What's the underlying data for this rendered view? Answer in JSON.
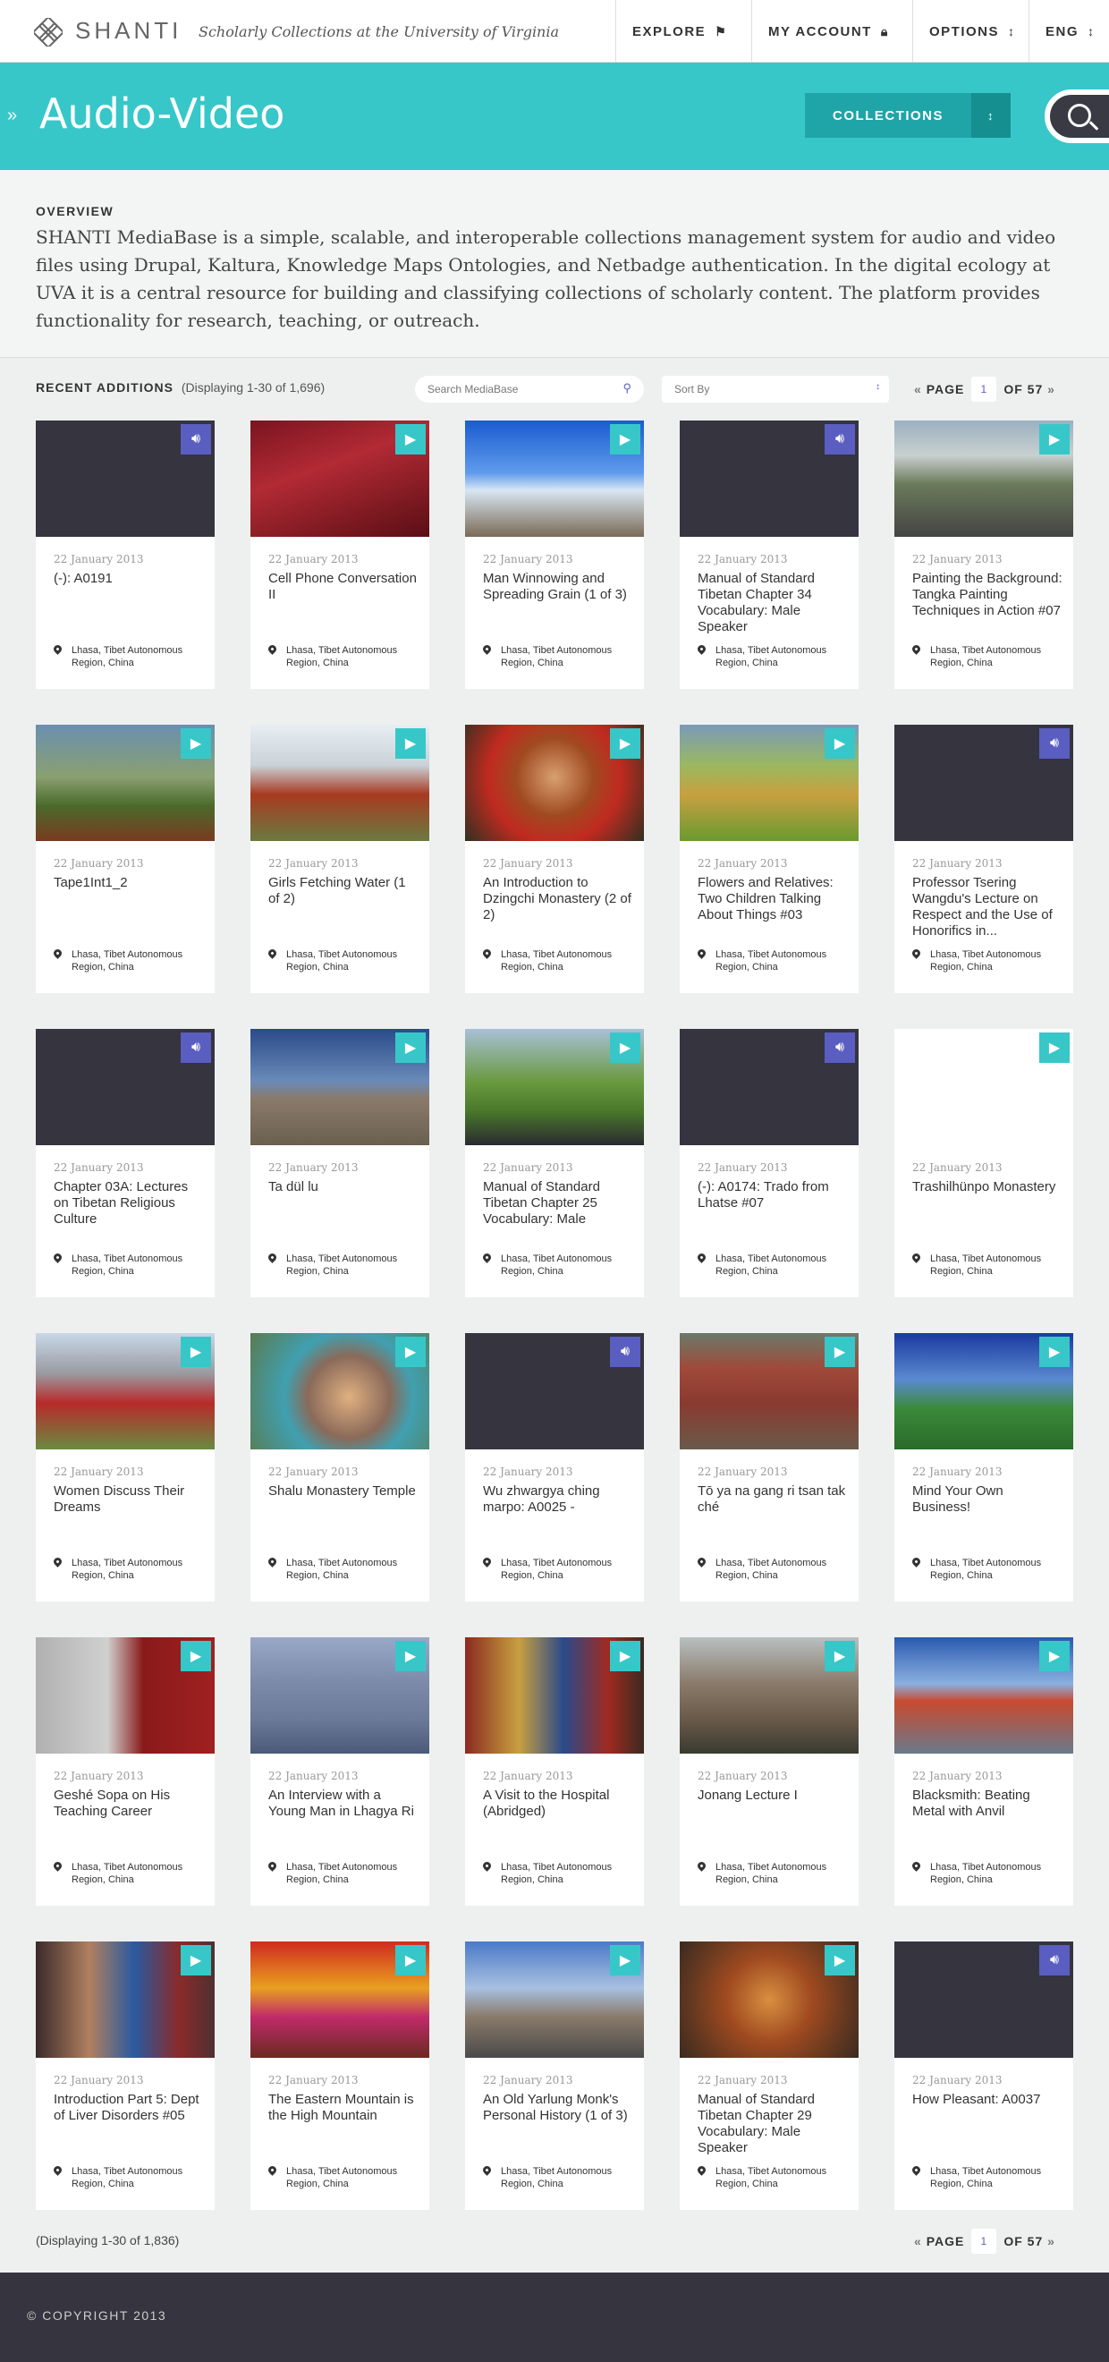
{
  "header": {
    "brand": "SHANTI",
    "tagline": "Scholarly Collections at the University of Virginia",
    "nav": [
      {
        "label": "EXPLORE",
        "icon": "signpost-icon"
      },
      {
        "label": "MY ACCOUNT",
        "icon": "lock-icon"
      },
      {
        "label": "OPTIONS",
        "icon": "updown-icon"
      },
      {
        "label": "ENG",
        "icon": "updown-icon"
      }
    ]
  },
  "band": {
    "title": "Audio-Video",
    "collections_label": "COLLECTIONS"
  },
  "overview": {
    "heading": "OVERVIEW",
    "text": "SHANTI MediaBase is a simple, scalable, and interoperable collections management system for audio and video files using Drupal, Kaltura, Knowledge Maps Ontologies, and Netbadge authentication. In the digital ecology at UVA it is a central resource for building and classifying collections of scholarly content. The platform provides functionality for research, teaching, or outreach."
  },
  "listing": {
    "heading": "RECENT ADDITIONS",
    "count_text": "(Displaying 1-30 of 1,696)",
    "search_placeholder": "Search MediaBase",
    "sort_label": "Sort By",
    "page_label": "PAGE",
    "page_current": "1",
    "page_of": "OF 57",
    "footer_count_text": "(Displaying 1-30 of 1,836)"
  },
  "colors": {
    "teal": "#37c7c9",
    "audio_purple": "#5a5ec0",
    "dark": "#35343f"
  },
  "cards": [
    {
      "type": "audio",
      "thumb": "none",
      "date": "22 January 2013",
      "title": "(-): A0191",
      "location": "Lhasa, Tibet Autonomous Region, China"
    },
    {
      "type": "video",
      "thumb": "monks",
      "date": "22 January 2013",
      "title": "Cell Phone Conversation II",
      "location": "Lhasa, Tibet Autonomous Region, China"
    },
    {
      "type": "video",
      "thumb": "flags",
      "date": "22 January 2013",
      "title": "Man Winnowing and Spreading Grain (1 of 3)",
      "location": "Lhasa, Tibet Autonomous Region, China"
    },
    {
      "type": "audio",
      "thumb": "none",
      "date": "22 January 2013",
      "title": "Manual of Standard Tibetan Chapter 34 Vocabulary: Male Speaker",
      "location": "Lhasa, Tibet Autonomous Region, China"
    },
    {
      "type": "video",
      "thumb": "road",
      "date": "22 January 2013",
      "title": "Painting the Background: Tangka Painting Techniques in Action #07",
      "location": "Lhasa, Tibet Autonomous Region, China"
    },
    {
      "type": "video",
      "thumb": "hills",
      "date": "22 January 2013",
      "title": "Tape1Int1_2",
      "location": "Lhasa, Tibet Autonomous Region, China"
    },
    {
      "type": "video",
      "thumb": "dancers",
      "date": "22 January 2013",
      "title": "Girls Fetching Water (1 of 2)",
      "location": "Lhasa, Tibet Autonomous Region, China"
    },
    {
      "type": "video",
      "thumb": "portrait",
      "date": "22 January 2013",
      "title": "An Introduction to Dzingchi Monastery (2 of 2)",
      "location": "Lhasa, Tibet Autonomous Region, China"
    },
    {
      "type": "video",
      "thumb": "grass",
      "date": "22 January 2013",
      "title": "Flowers and Relatives: Two Children Talking About Things #03",
      "location": "Lhasa, Tibet Autonomous Region, China"
    },
    {
      "type": "audio",
      "thumb": "none",
      "date": "22 January 2013",
      "title": "Professor Tsering Wangdu's Lecture on Respect and the Use of Honorifics in...",
      "location": "Lhasa, Tibet Autonomous Region, China"
    },
    {
      "type": "audio",
      "thumb": "none",
      "date": "22 January 2013",
      "title": "Chapter 03A: Lectures on Tibetan Religious Culture",
      "location": "Lhasa, Tibet Autonomous Region, China"
    },
    {
      "type": "video",
      "thumb": "palace",
      "date": "22 January 2013",
      "title": "Ta dül lu",
      "location": "Lhasa, Tibet Autonomous Region, China"
    },
    {
      "type": "video",
      "thumb": "meadow",
      "date": "22 January 2013",
      "title": "Manual of Standard Tibetan Chapter 25 Vocabulary: Male",
      "location": "Lhasa, Tibet Autonomous Region, China"
    },
    {
      "type": "audio",
      "thumb": "none",
      "date": "22 January 2013",
      "title": "(-): A0174: Trado from Lhatse #07",
      "location": "Lhasa, Tibet Autonomous Region, China"
    },
    {
      "type": "video",
      "thumb": "blank",
      "date": "22 January 2013",
      "title": "Trashilhünpo Monastery",
      "location": "Lhasa, Tibet Autonomous Region, China"
    },
    {
      "type": "video",
      "thumb": "women",
      "date": "22 January 2013",
      "title": "Women Discuss Their Dreams",
      "location": "Lhasa, Tibet Autonomous Region, China"
    },
    {
      "type": "video",
      "thumb": "girl",
      "date": "22 January 2013",
      "title": "Shalu Monastery Temple",
      "location": "Lhasa, Tibet Autonomous Region, China"
    },
    {
      "type": "audio",
      "thumb": "none",
      "date": "22 January 2013",
      "title": "Wu zhwargya ching marpo: A0025 -",
      "location": "Lhasa, Tibet Autonomous Region, China"
    },
    {
      "type": "video",
      "thumb": "town",
      "date": "22 January 2013",
      "title": "Tō ya na gang ri tsan tak ché",
      "location": "Lhasa, Tibet Autonomous Region, China"
    },
    {
      "type": "video",
      "thumb": "river",
      "date": "22 January 2013",
      "title": "Mind Your Own Business!",
      "location": "Lhasa, Tibet Autonomous Region, China"
    },
    {
      "type": "video",
      "thumb": "monk",
      "date": "22 January 2013",
      "title": "Geshé Sopa on His Teaching Career",
      "location": "Lhasa, Tibet Autonomous Region, China"
    },
    {
      "type": "video",
      "thumb": "terraces",
      "date": "22 January 2013",
      "title": "An Interview with a Young Man in Lhagya Ri",
      "location": "Lhasa, Tibet Autonomous Region, China"
    },
    {
      "type": "video",
      "thumb": "market",
      "date": "22 January 2013",
      "title": "A Visit to the Hospital (Abridged)",
      "location": "Lhasa, Tibet Autonomous Region, China"
    },
    {
      "type": "video",
      "thumb": "village",
      "date": "22 January 2013",
      "title": "Jonang Lecture I",
      "location": "Lhasa, Tibet Autonomous Region, China"
    },
    {
      "type": "video",
      "thumb": "sunflags",
      "date": "22 January 2013",
      "title": "Blacksmith: Beating Metal with Anvil",
      "location": "Lhasa, Tibet Autonomous Region, China"
    },
    {
      "type": "video",
      "thumb": "crowd",
      "date": "22 January 2013",
      "title": "Introduction Part 5: Dept of Liver Disorders #05",
      "location": "Lhasa, Tibet Autonomous Region, China"
    },
    {
      "type": "video",
      "thumb": "lanterns",
      "date": "22 January 2013",
      "title": "The Eastern Mountain is the High Mountain",
      "location": "Lhasa, Tibet Autonomous Region, China"
    },
    {
      "type": "video",
      "thumb": "street",
      "date": "22 January 2013",
      "title": "An Old Yarlung Monk's Personal History (1 of 3)",
      "location": "Lhasa, Tibet Autonomous Region, China"
    },
    {
      "type": "video",
      "thumb": "spices",
      "date": "22 January 2013",
      "title": "Manual of Standard Tibetan Chapter 29 Vocabulary: Male Speaker",
      "location": "Lhasa, Tibet Autonomous Region, China"
    },
    {
      "type": "audio",
      "thumb": "none",
      "date": "22 January 2013",
      "title": "How Pleasant: A0037",
      "location": "Lhasa, Tibet Autonomous Region, China"
    }
  ],
  "footer": {
    "copyright": "© COPYRIGHT 2013"
  }
}
